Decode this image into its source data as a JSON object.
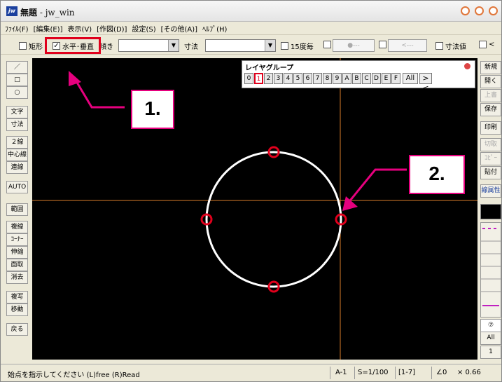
{
  "window": {
    "app_name": "無題",
    "app_suffix": " - jw_win",
    "logo": "jw"
  },
  "menu": [
    "ﾌｧｲﾙ(F)",
    "[編集(E)]",
    "表示(V)",
    "[作図(D)]",
    "設定(S)",
    "[その他(A)]",
    "ﾍﾙﾌﾟ(H)"
  ],
  "toolbar": {
    "rect_label": "矩形",
    "hv_label": "水平･垂直",
    "hv_checked": "✓",
    "tilt_label": "傾き",
    "dim_label": "寸法",
    "deg15_label": "15度毎",
    "dotline1": "●---",
    "dotline2": "<---",
    "dimval_label": "寸法値",
    "lt_label": "<"
  },
  "left_tools": [
    "／",
    "□",
    "○",
    "文字",
    "寸法",
    "２線",
    "中心線",
    "連線",
    "AUTO",
    "範囲",
    "複線",
    "ｺｰﾅｰ",
    "伸縮",
    "面取",
    "消去",
    "複写",
    "移動",
    "戻る"
  ],
  "right_tools": [
    "新規",
    "開く",
    "上書",
    "保存",
    "印刷",
    "切取",
    "ｺﾋﾟｰ",
    "貼付",
    "線属性"
  ],
  "right_tools_disabled": [
    "上書",
    "切取",
    "ｺﾋﾟｰ"
  ],
  "right_bottom": {
    "layer_num": "⑦",
    "all": "All",
    "one": "1"
  },
  "layer_panel": {
    "title": "レイヤグループ",
    "zero": "0",
    "buttons": [
      "1",
      "2",
      "3",
      "4",
      "5",
      "6",
      "7",
      "8",
      "9",
      "A",
      "B",
      "C",
      "D",
      "E",
      "F"
    ],
    "active": "1",
    "all": "All",
    "close": "><"
  },
  "annotations": {
    "one": "1.",
    "two": "2."
  },
  "status": {
    "message": "始点を指示してください (L)free (R)Read",
    "layer": "A-1",
    "scale": "S=1/100",
    "range": "[1-7]",
    "angle": "∠0",
    "zoom": "× 0.66"
  },
  "colors": {
    "highlight": "#e0001c",
    "annotation": "#e6007e",
    "crosshair": "#d97b2a",
    "canvas": "#000000"
  }
}
